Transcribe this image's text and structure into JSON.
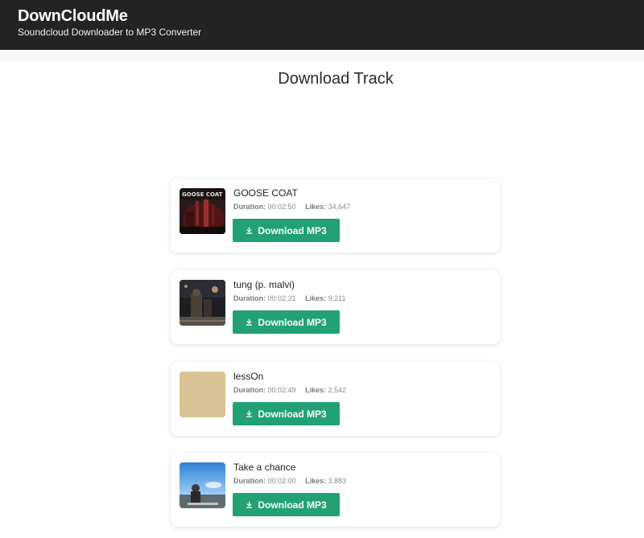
{
  "header": {
    "brand": "DownCloudMe",
    "tagline": "Soundcloud Downloader to MP3 Converter",
    "background": "#232323"
  },
  "page": {
    "title": "Download Track"
  },
  "labels": {
    "duration": "Duration:",
    "likes": "Likes:",
    "download_button": "Download MP3",
    "download_icon": "download-arrow-icon"
  },
  "accent_color": "#21a174",
  "tracks": [
    {
      "title": "GOOSE COAT",
      "duration": "00:02:50",
      "likes": "34,647",
      "artwork_text": "GOOSE COAT",
      "artwork": "dark-red-cover"
    },
    {
      "title": "tung (p. malvi)",
      "duration": "00:02:31",
      "likes": "9,211",
      "artwork": "night-street-photo"
    },
    {
      "title": "lessOn",
      "duration": "00:02:49",
      "likes": "2,542",
      "artwork": "plain-beige",
      "artwork_color": "#d9c293"
    },
    {
      "title": "Take a chance",
      "duration": "00:02:00",
      "likes": "3,883",
      "artwork": "sky-photo"
    }
  ]
}
